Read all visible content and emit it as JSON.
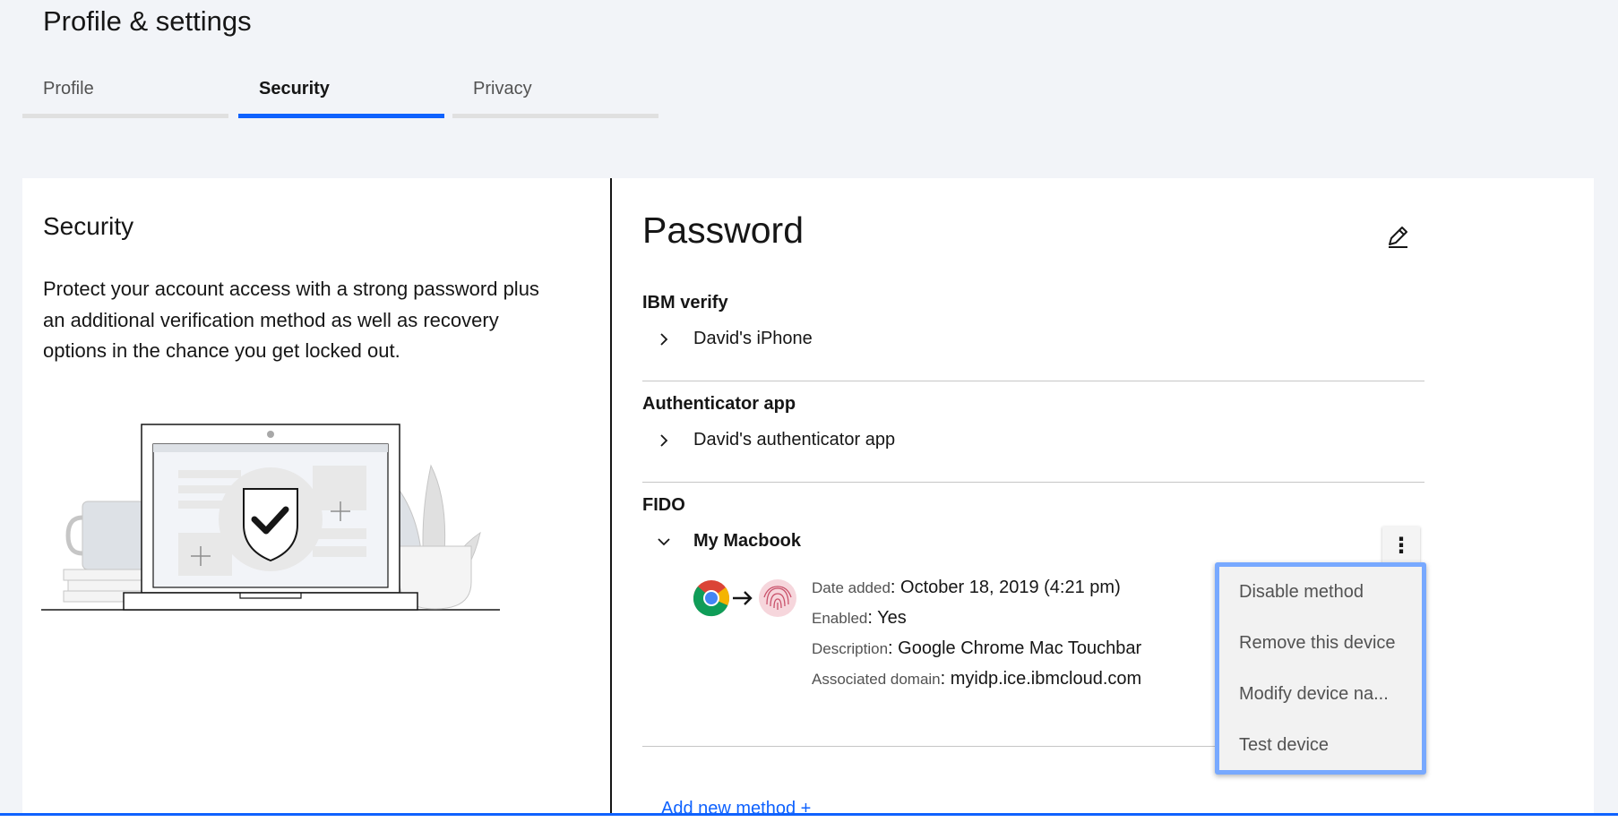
{
  "page": {
    "title": "Profile & settings"
  },
  "tabs": [
    {
      "label": "Profile",
      "active": false
    },
    {
      "label": "Security",
      "active": true
    },
    {
      "label": "Privacy",
      "active": false
    }
  ],
  "left": {
    "title": "Security",
    "description": "Protect your account access with a strong password plus an additional verification method as well as recovery options in the chance you get locked out."
  },
  "password": {
    "title": "Password",
    "edit_icon": "pencil-icon"
  },
  "sections": {
    "ibm_verify": {
      "heading": "IBM verify",
      "device": "David's iPhone"
    },
    "authenticator": {
      "heading": "Authenticator app",
      "device": "David's authenticator app"
    },
    "fido": {
      "heading": "FIDO",
      "device": "My Macbook",
      "details": {
        "date_added_key": "Date added",
        "date_added_value": "October 18, 2019 (4:21 pm)",
        "enabled_key": "Enabled",
        "enabled_value": "Yes",
        "description_key": "Description",
        "description_value": "Google Chrome Mac Touchbar",
        "domain_key": "Associated domain",
        "domain_value": "myidp.ice.ibmcloud.com"
      }
    }
  },
  "overflow_menu": {
    "trigger": "⋮",
    "items": [
      "Disable method",
      "Remove this device",
      "Modify device na...",
      "Test device"
    ]
  },
  "add_method": "Add new method +",
  "colors": {
    "accent": "#0f62fe",
    "menu_focus": "#78a9ff",
    "background": "#f2f4f8"
  }
}
